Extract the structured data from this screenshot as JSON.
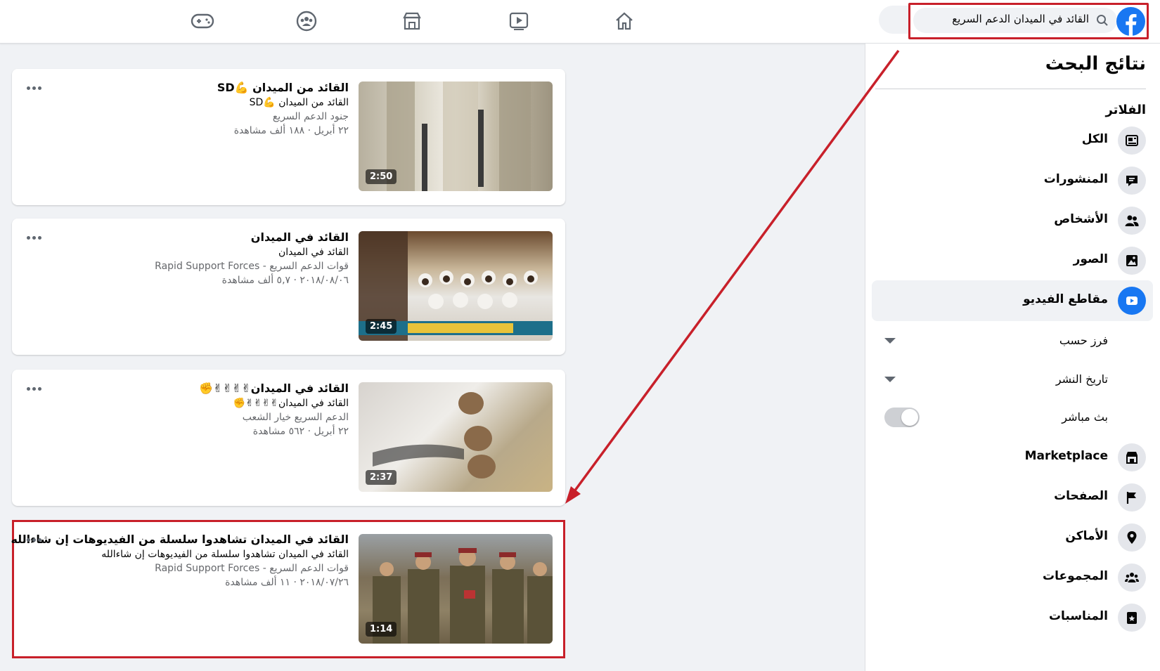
{
  "search": {
    "query": "القائد في الميدان الدعم السريع"
  },
  "sidebar": {
    "title": "نتائج البحث",
    "filters_label": "الفلاتر",
    "items": [
      {
        "label": "الكل",
        "icon": "all-results-icon"
      },
      {
        "label": "المنشورات",
        "icon": "posts-icon"
      },
      {
        "label": "الأشخاص",
        "icon": "people-icon"
      },
      {
        "label": "الصور",
        "icon": "photos-icon"
      },
      {
        "label": "مقاطع الفيديو",
        "icon": "video-icon",
        "active": true
      },
      {
        "label": "Marketplace",
        "icon": "marketplace-icon"
      },
      {
        "label": "الصفحات",
        "icon": "flag-icon"
      },
      {
        "label": "الأماكن",
        "icon": "location-pin-icon"
      },
      {
        "label": "المجموعات",
        "icon": "groups-icon"
      },
      {
        "label": "المناسبات",
        "icon": "calendar-icon"
      }
    ],
    "video_filters": {
      "sort_by": "فرز حسب",
      "date_posted": "تاريخ النشر",
      "live": "بث مباشر"
    }
  },
  "results": [
    {
      "title": "القائد من الميدان 💪SD",
      "subtitle": "القائد من الميدان 💪SD",
      "channel": "جنود الدعم السريع",
      "stats": "٢٢ أبريل · ١٨٨ ألف مشاهدة",
      "duration": "2:50"
    },
    {
      "title": "القائد في الميدان",
      "subtitle": "القائد في الميدان",
      "channel": "قوات الدعم السريع - Rapid Support Forces",
      "stats": "٢٠١٨/٠٨/٠٦ · ٥,٧ ألف مشاهدة",
      "duration": "2:45"
    },
    {
      "title": "القائد في الميدان✌✌✌✌✊",
      "subtitle": "القائد في الميدان✌✌✌✌✊",
      "channel": "الدعم السريع خيار الشعب",
      "stats": "٢٢ أبريل · ٥٦٢ مشاهدة",
      "duration": "2:37"
    },
    {
      "title": "القائد في الميدان تشاهدوا سلسلة من الفيديوهات إن شاءالله",
      "subtitle": "القائد في الميدان تشاهدوا سلسلة من الفيديوهات إن شاءالله",
      "channel": "قوات الدعم السريع - Rapid Support Forces",
      "stats": "٢٠١٨/٠٧/٢٦ · ١١ ألف مشاهدة",
      "duration": "1:14"
    }
  ],
  "colors": {
    "accent": "#1877f2",
    "highlight": "#c8202a"
  }
}
